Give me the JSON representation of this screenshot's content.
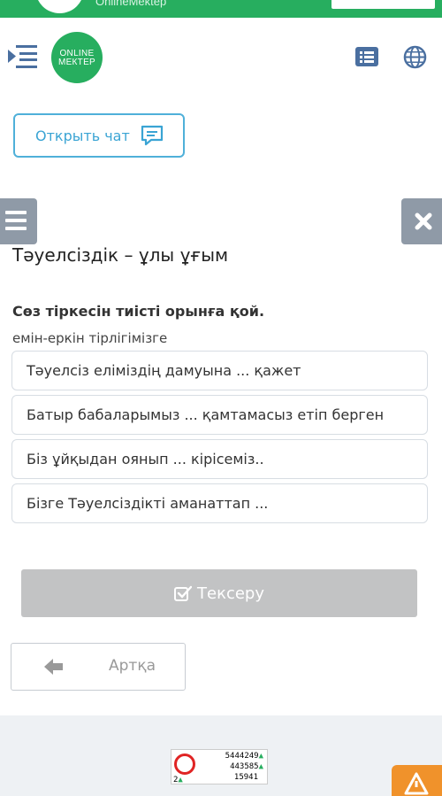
{
  "topbar": {
    "brand": "OnlineMektep"
  },
  "header": {
    "logo_line1": "ONLINE",
    "logo_line2": "МЕКТЕР",
    "icons": [
      "menu-icon",
      "list-icon",
      "globe-icon"
    ]
  },
  "chat": {
    "label": "Открыть чат",
    "icon": "chat-icon"
  },
  "lesson": {
    "title": "Тәуелсіздік – ұлы ұғым"
  },
  "task": {
    "title": "Сөз тіркесін тиісті орынға қой.",
    "drag_word": "емін-еркін тірлігімізге",
    "options": [
      "Тәуелсіз еліміздің дамуына ... қажет",
      "Батыр бабаларымыз ... қамтамасыз етіп берген",
      "Біз ұйқыдан оянып ... кірісеміз..",
      "Бізге Тәуелсіздікті аманаттап ..."
    ]
  },
  "buttons": {
    "check": "Тексеру",
    "back": "Артқа"
  },
  "counter": {
    "line1": "5444249",
    "line2": "443585",
    "line3": "15941",
    "small": "2"
  },
  "colors": {
    "brand_green": "#27ae5f",
    "chat_blue": "#3aa4d4",
    "side_gray": "#8f9aa7",
    "warn_orange": "#f0922b"
  }
}
